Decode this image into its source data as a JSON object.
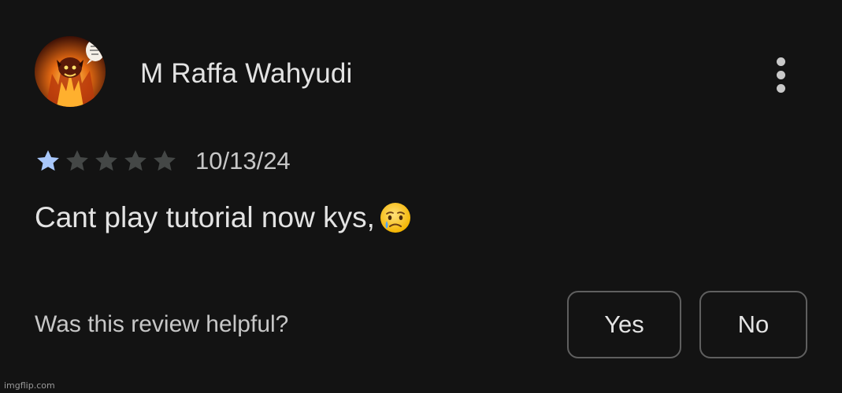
{
  "review": {
    "reviewer_name": "M Raffa Wahyudi",
    "avatar_icon": "fiery-character-avatar",
    "more_options_icon": "more-vert-icon",
    "rating": 1,
    "max_rating": 5,
    "star_filled_color": "#a8c7fa",
    "star_empty_color": "#444746",
    "date": "10/13/24",
    "text": "Cant play tutorial now kys,",
    "emoji_icon": "crying-face-emoji"
  },
  "helpful": {
    "question": "Was this review helpful?",
    "yes_label": "Yes",
    "no_label": "No"
  },
  "watermark": "imgflip.com"
}
